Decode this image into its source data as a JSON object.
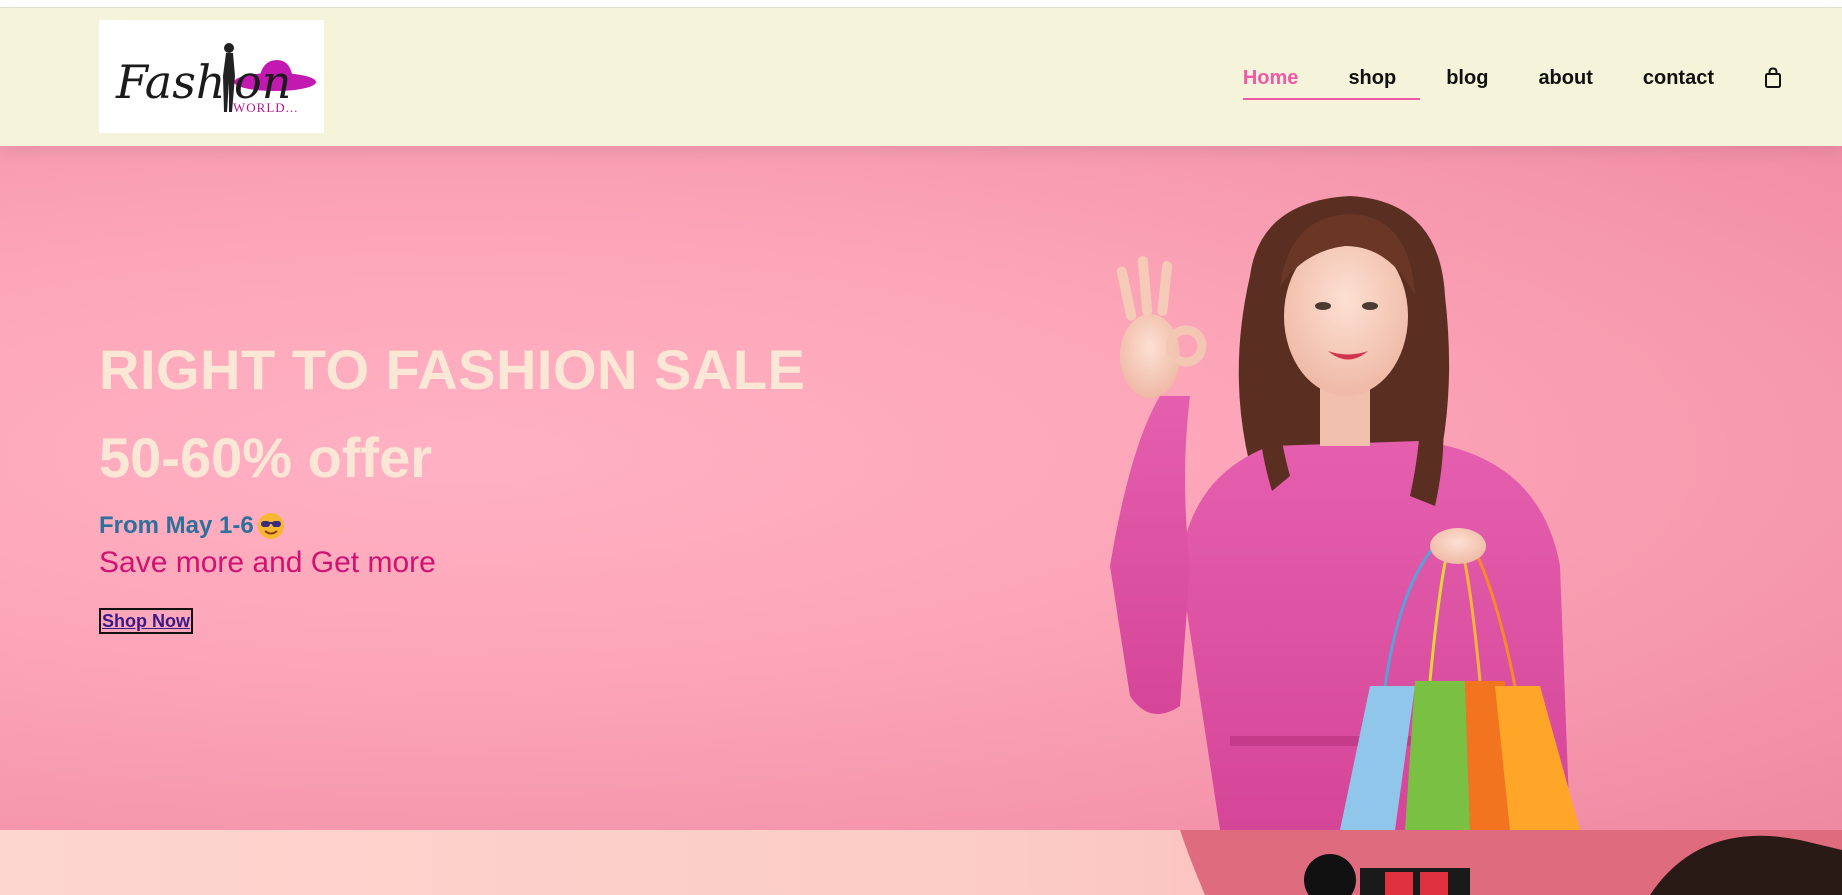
{
  "brand": {
    "logo_word": "Fashion",
    "logo_sub": "WORLD..."
  },
  "nav": {
    "items": [
      {
        "label": "Home",
        "active": true
      },
      {
        "label": "shop",
        "active": false
      },
      {
        "label": "blog",
        "active": false
      },
      {
        "label": "about",
        "active": false
      },
      {
        "label": "contact",
        "active": false
      }
    ],
    "cart_icon": "shopping-bag-icon"
  },
  "hero": {
    "title": "RIGHT TO FASHION SALE",
    "offer": "50-60% offer",
    "date_text": "From May 1-6",
    "date_emoji": "smiling-face-with-sunglasses-icon",
    "subtitle": "Save more and Get more",
    "cta_label": "Shop Now",
    "image": "woman-with-shopping-bags-photo"
  },
  "colors": {
    "header_bg": "#f5f4db",
    "accent_pink": "#ef5aa6",
    "hero_bg": "#fda6b9",
    "title_cream": "#fbe7d6",
    "date_blue": "#2f6f9b",
    "subtitle_magenta": "#cf1274",
    "cta_text": "#3b1a86"
  }
}
